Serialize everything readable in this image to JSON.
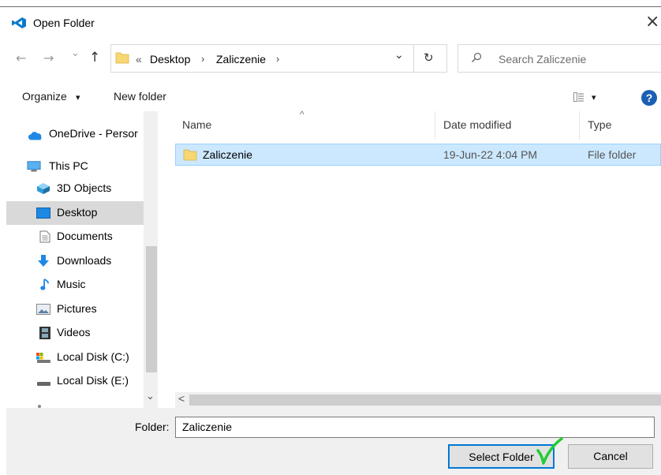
{
  "window": {
    "title": "Open Folder",
    "close_glyph": "×"
  },
  "nav": {
    "back_glyph": "←",
    "forward_glyph": "→",
    "recent_glyph": "⌄",
    "up_glyph": "↑",
    "breadcrumb_overflow": "«",
    "breadcrumb": [
      "Desktop",
      "Zaliczenie"
    ],
    "separator": "›",
    "dropdown_glyph": "⌄",
    "refresh_glyph": "↻",
    "search_placeholder": "Search Zaliczenie"
  },
  "commands": {
    "organize": "Organize",
    "organize_arrow": "▾",
    "new_folder": "New folder",
    "view_arrow": "▾",
    "help_glyph": "?"
  },
  "sidebar": {
    "items": [
      {
        "label": "OneDrive - Persor",
        "icon": "onedrive-icon"
      },
      {
        "label": "This PC",
        "icon": "this-pc-icon"
      },
      {
        "label": "3D Objects",
        "icon": "3d-objects-icon"
      },
      {
        "label": "Desktop",
        "icon": "desktop-icon",
        "selected": true
      },
      {
        "label": "Documents",
        "icon": "documents-icon"
      },
      {
        "label": "Downloads",
        "icon": "downloads-icon"
      },
      {
        "label": "Music",
        "icon": "music-icon"
      },
      {
        "label": "Pictures",
        "icon": "pictures-icon"
      },
      {
        "label": "Videos",
        "icon": "videos-icon"
      },
      {
        "label": "Local Disk (C:)",
        "icon": "local-disk-c-icon"
      },
      {
        "label": "Local Disk (E:)",
        "icon": "local-disk-e-icon"
      }
    ],
    "scroll_up": "^",
    "scroll_down": "⌄"
  },
  "files": {
    "columns": [
      "Name",
      "Date modified",
      "Type"
    ],
    "sort_glyph": "^",
    "rows": [
      {
        "name": "Zaliczenie",
        "date": "19-Jun-22 4:04 PM",
        "type": "File folder"
      }
    ],
    "scroll_left": "<"
  },
  "footer": {
    "folder_label": "Folder:",
    "folder_value": "Zaliczenie",
    "select_button": "Select Folder",
    "cancel_button": "Cancel"
  },
  "colors": {
    "selection": "#cce8ff",
    "accent": "#0078d7",
    "folder": "#f7d774",
    "checkmark": "#22cc33"
  }
}
